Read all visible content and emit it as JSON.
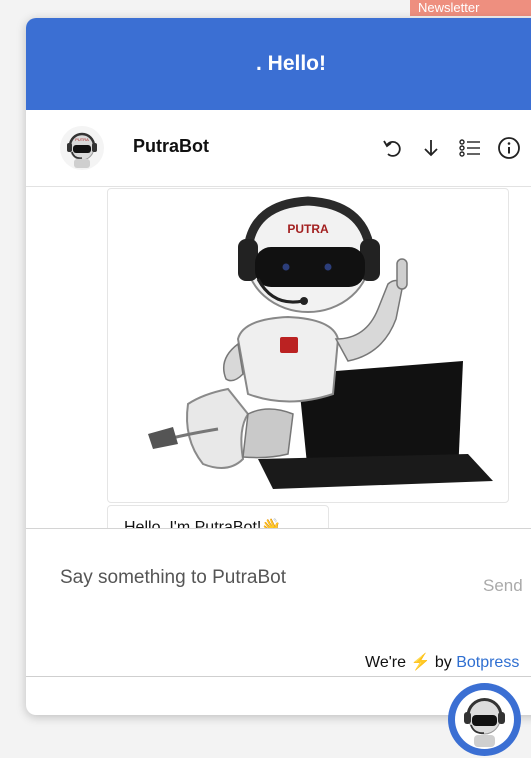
{
  "background": {
    "tab_label": "Newsletter"
  },
  "header": {
    "title": ". Hello!",
    "color": "#3b6fd3"
  },
  "bot_bar": {
    "bot_name": "PutraBot",
    "avatar_icon": "robot-avatar-icon",
    "tools": [
      {
        "name": "reset-conversation-icon",
        "glyph": "undo-arrow"
      },
      {
        "name": "download-transcript-icon",
        "glyph": "down-arrow"
      },
      {
        "name": "conversations-list-icon",
        "glyph": "list"
      },
      {
        "name": "info-icon",
        "glyph": "circle-i"
      }
    ]
  },
  "conversation": {
    "image_message": {
      "label_on_helmet": "PUTRA"
    },
    "text_message": "Hello, I'm PutraBot!👋"
  },
  "composer": {
    "placeholder": "Say something to PutraBot",
    "send_label": "Send"
  },
  "footer": {
    "prefix": "We're",
    "bolt_glyph": "⚡",
    "by_text": "by",
    "brand": "Botpress"
  },
  "launcher": {
    "icon": "robot-launcher-icon",
    "color": "#3b6fd3"
  }
}
